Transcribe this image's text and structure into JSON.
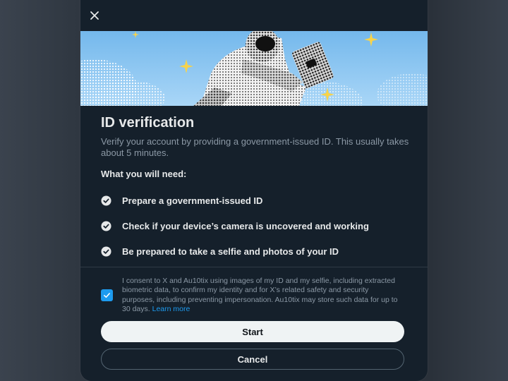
{
  "dialog": {
    "title": "ID verification",
    "subtitle": "Verify your account by providing a government-issued ID. This usually takes about 5 minutes.",
    "needs_heading": "What you will need:",
    "requirements": [
      {
        "label": "Prepare a government-issued ID",
        "icon": "check-circle-icon"
      },
      {
        "label": "Check if your device’s camera is uncovered and working",
        "icon": "check-circle-icon"
      },
      {
        "label": "Be prepared to take a selfie and photos of your ID",
        "icon": "check-circle-icon"
      }
    ],
    "consent": {
      "checked": true,
      "text": "I consent to X and Au10tix using images of my ID and my selfie, including extracted biometric data, to confirm my identity and for X’s related safety and security purposes, including preventing impersonation. Au10tix may store such data for up to 30 days.",
      "link_label": "Learn more"
    },
    "start_label": "Start",
    "cancel_label": "Cancel",
    "close_icon": "close-icon"
  },
  "colors": {
    "background": "#15202b",
    "accent": "#1d9bf0",
    "text_primary": "#e7e9ea",
    "text_secondary": "#8b98a5",
    "banner_sky": "#8ec8f2"
  }
}
